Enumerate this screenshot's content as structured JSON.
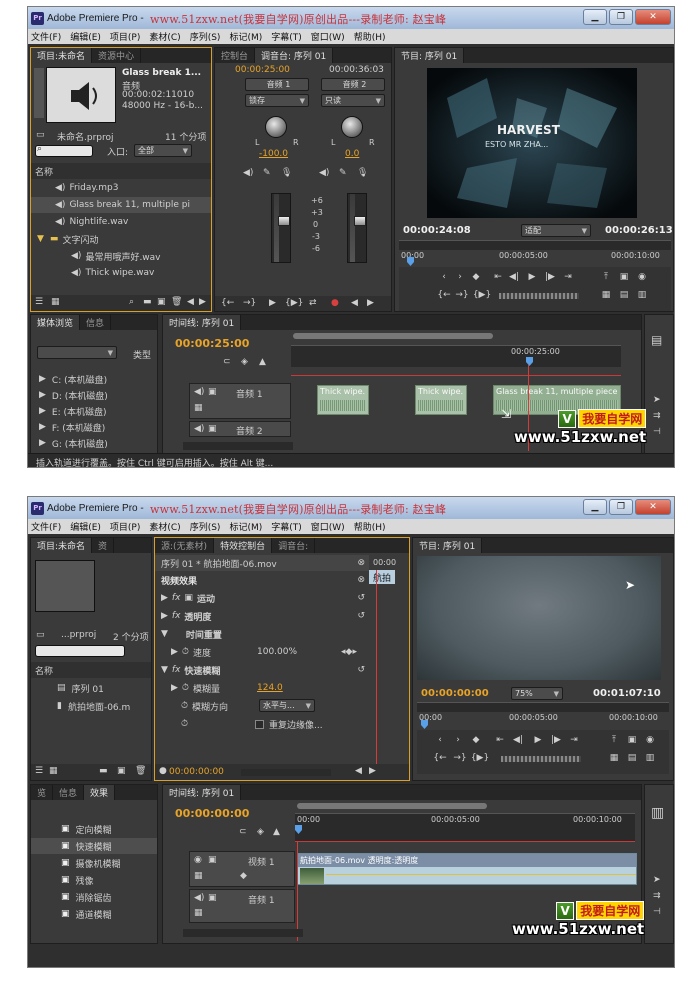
{
  "app": {
    "title": "Adobe Premiere Pro -",
    "watermark_title": "www.51zxw.net(我要自学网)原创出品---录制老师: 赵宝峰",
    "icon_text": "Pr"
  },
  "menu": [
    "文件(F)",
    "编辑(E)",
    "项目(P)",
    "素材(C)",
    "序列(S)",
    "标记(M)",
    "字幕(T)",
    "窗口(W)",
    "帮助(H)"
  ],
  "brand": {
    "cn": "我要自学网",
    "url": "www.51zxw.net"
  },
  "shot1": {
    "project_panel": {
      "tabs": [
        "项目:未命名",
        "资源中心"
      ],
      "preview_name": "Glass break 1...",
      "preview_type": "音频",
      "preview_duration": "00:00:02:11010",
      "preview_format": "48000 Hz - 16-b...",
      "project_file": "未命名.prproj",
      "item_count": "11 个分项",
      "entry_label": "入口:",
      "entry_value": "全部",
      "name_header": "名称",
      "items": [
        "Friday.mp3",
        "Glass break 11, multiple pi",
        "Nightlife.wav",
        "文字闪动",
        "最常用哦声好.wav",
        "Thick wipe.wav"
      ]
    },
    "mixer_panel": {
      "tabs": [
        "控制台",
        "调音台: 序列 01"
      ],
      "tc_left": "00:00:25:00",
      "tc_right": "00:00:36:03",
      "channel1": "音频 1",
      "channel2": "音频 2",
      "mode1": "锁存",
      "mode2": "只读",
      "val1": "-100.0",
      "val2": "0.0",
      "knob_l": "L",
      "knob_r": "R",
      "db_marks": [
        "+6",
        "+3",
        "0",
        "-3",
        "-6"
      ]
    },
    "program_panel": {
      "tabs": [
        "节目: 序列 01"
      ],
      "overlay_title": "HARVEST",
      "overlay_sub": "ESTO MR ZHA...",
      "tc_left": "00:00:24:08",
      "fit": "适配",
      "tc_right": "00:00:26:13",
      "ruler": [
        "00:00",
        "00:00:05:00",
        "00:00:10:00"
      ]
    },
    "media_panel": {
      "tabs": [
        "媒体浏览",
        "信息"
      ],
      "type_label": "类型",
      "drives": [
        "C: (本机磁盘)",
        "D: (本机磁盘)",
        "E: (本机磁盘)",
        "F: (本机磁盘)",
        "G: (本机磁盘)"
      ]
    },
    "timeline": {
      "tab": "时间线: 序列 01",
      "tc": "00:00:25:00",
      "ruler_tc": "00:00:25:00",
      "track1": "音频 1",
      "track2": "音频 2",
      "clips": [
        "Thick wipe.",
        "Thick wipe.",
        "Glass break 11, multiple piece"
      ]
    },
    "status": "插入轨道进行覆盖。按住 Ctrl 键可启用插入。按住 Alt 键..."
  },
  "shot2": {
    "project_panel": {
      "tabs": [
        "项目:未命名",
        "资"
      ],
      "project_file": "...prproj",
      "item_count": "2 个分项",
      "name_header": "名称",
      "items": [
        "序列 01",
        "航拍地面-06.m"
      ]
    },
    "effects_control": {
      "tabs": [
        "源:(无素材)",
        "特效控制台",
        "调音台:"
      ],
      "clip_header": "序列 01 * 航拍地面-06.mov",
      "ruler_tc": "00:00",
      "clip_tag": "航拍",
      "section": "视频效果",
      "motion": "运动",
      "opacity": "透明度",
      "time_remap": "时间重置",
      "speed_label": "速度",
      "speed_value": "100.00%",
      "fast_blur": "快速模糊",
      "blur_label": "模糊量",
      "blur_value": "124.0",
      "blur_dir_label": "模糊方向",
      "blur_dir_value": "水平与...",
      "repeat_edge": "重复边缘像...",
      "bottom_tc": "00:00:00:00"
    },
    "program_panel": {
      "tabs": [
        "节目: 序列 01"
      ],
      "tc_left": "00:00:00:00",
      "zoom": "75%",
      "tc_right": "00:01:07:10",
      "ruler": [
        "00:00",
        "00:00:05:00",
        "00:00:10:00"
      ]
    },
    "effects_panel": {
      "tabs": [
        "览",
        "信息",
        "效果"
      ],
      "items": [
        "定向模糊",
        "快速模糊",
        "摄像机模糊",
        "残像",
        "消除锯齿",
        "通道模糊"
      ]
    },
    "timeline": {
      "tab": "时间线: 序列 01",
      "tc": "00:00:00:00",
      "ruler": [
        "00:00",
        "00:00:05:00",
        "00:00:10:00"
      ],
      "track_video": "视频 1",
      "track_audio": "音频 1",
      "clip_label": "航拍地面-06.mov 透明度:透明度"
    }
  }
}
